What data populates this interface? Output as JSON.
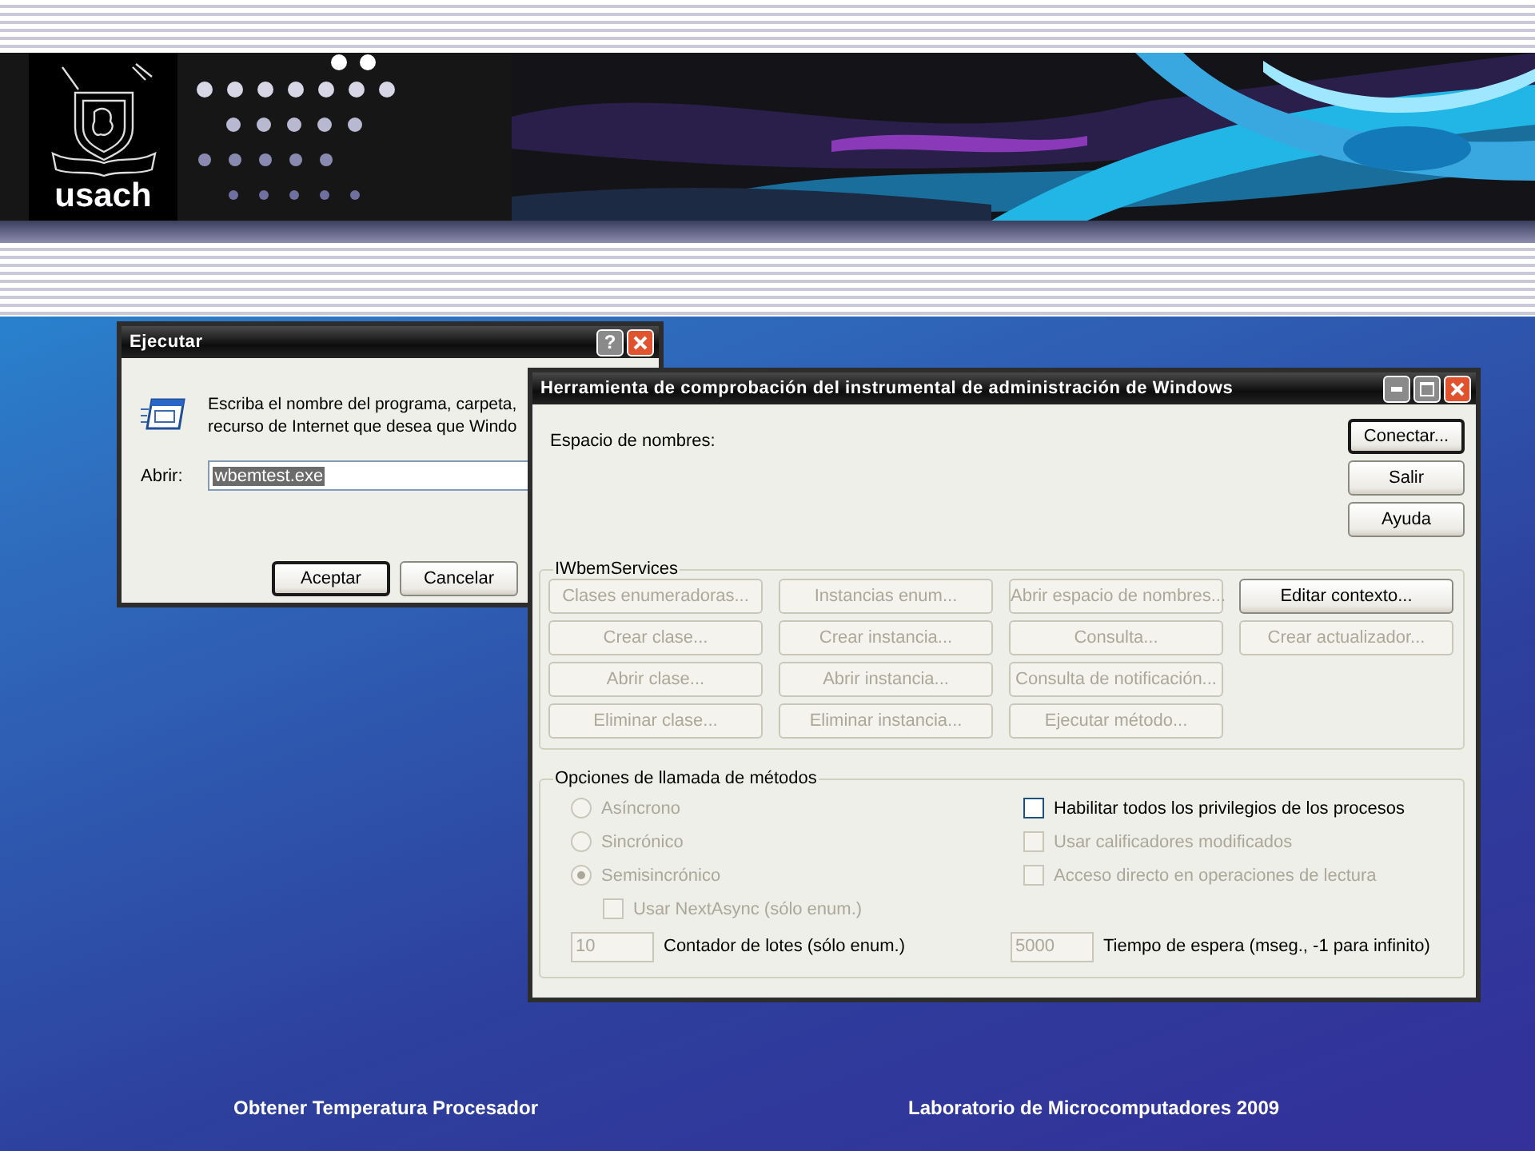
{
  "header": {
    "logo_text": "usach"
  },
  "run_dialog": {
    "title": "Ejecutar",
    "help": "?",
    "lines": [
      "Escriba el nombre del programa, carpeta,",
      "recurso de Internet que desea que Windo"
    ],
    "open_label": "Abrir:",
    "open_value": "wbemtest.exe",
    "buttons": [
      {
        "label": "Aceptar",
        "default": true
      },
      {
        "label": "Cancelar",
        "default": false
      }
    ]
  },
  "wmi_window": {
    "title": "Herramienta de comprobación del instrumental de administración de Windows",
    "namespace_label": "Espacio de nombres:",
    "side_buttons": [
      {
        "label": "Conectar...",
        "default": true,
        "disabled": false
      },
      {
        "label": "Salir",
        "default": false,
        "disabled": false
      },
      {
        "label": "Ayuda",
        "default": false,
        "disabled": false
      }
    ],
    "services": {
      "legend": "IWbemServices",
      "columns": [
        [
          {
            "label": "Clases enumeradoras...",
            "disabled": true
          },
          {
            "label": "Crear clase...",
            "disabled": true
          },
          {
            "label": "Abrir clase...",
            "disabled": true
          },
          {
            "label": "Eliminar clase...",
            "disabled": true
          }
        ],
        [
          {
            "label": "Instancias enum...",
            "disabled": true
          },
          {
            "label": "Crear instancia...",
            "disabled": true
          },
          {
            "label": "Abrir instancia...",
            "disabled": true
          },
          {
            "label": "Eliminar instancia...",
            "disabled": true
          }
        ],
        [
          {
            "label": "Abrir espacio de nombres...",
            "disabled": true
          },
          {
            "label": "Consulta...",
            "disabled": true
          },
          {
            "label": "Consulta de notificación...",
            "disabled": true
          },
          {
            "label": "Ejecutar método...",
            "disabled": true
          }
        ],
        [
          {
            "label": "Editar contexto...",
            "disabled": false
          },
          {
            "label": "Crear actualizador...",
            "disabled": true
          }
        ]
      ]
    },
    "options": {
      "legend": "Opciones de llamada de métodos",
      "radios": [
        {
          "label": "Asíncrono",
          "selected": false,
          "disabled": true
        },
        {
          "label": "Sincrónico",
          "selected": false,
          "disabled": true
        },
        {
          "label": "Semisincrónico",
          "selected": true,
          "disabled": true
        }
      ],
      "next_async": {
        "label": "Usar NextAsync (sólo enum.)",
        "checked": false,
        "disabled": true
      },
      "batch": {
        "value": "10",
        "label": "Contador de lotes (sólo enum.)",
        "disabled": true
      },
      "checkboxes": [
        {
          "label": "Habilitar todos los privilegios de los procesos",
          "checked": false,
          "disabled": false
        },
        {
          "label": "Usar calificadores modificados",
          "checked": false,
          "disabled": true
        },
        {
          "label": "Acceso directo en operaciones de lectura",
          "checked": false,
          "disabled": true
        }
      ],
      "timeout": {
        "value": "5000",
        "label": "Tiempo de espera (mseg., -1 para infinito)",
        "disabled": true
      }
    }
  },
  "footer": {
    "left": "Obtener Temperatura Procesador",
    "right": "Laboratorio de Microcomputadores 2009"
  }
}
